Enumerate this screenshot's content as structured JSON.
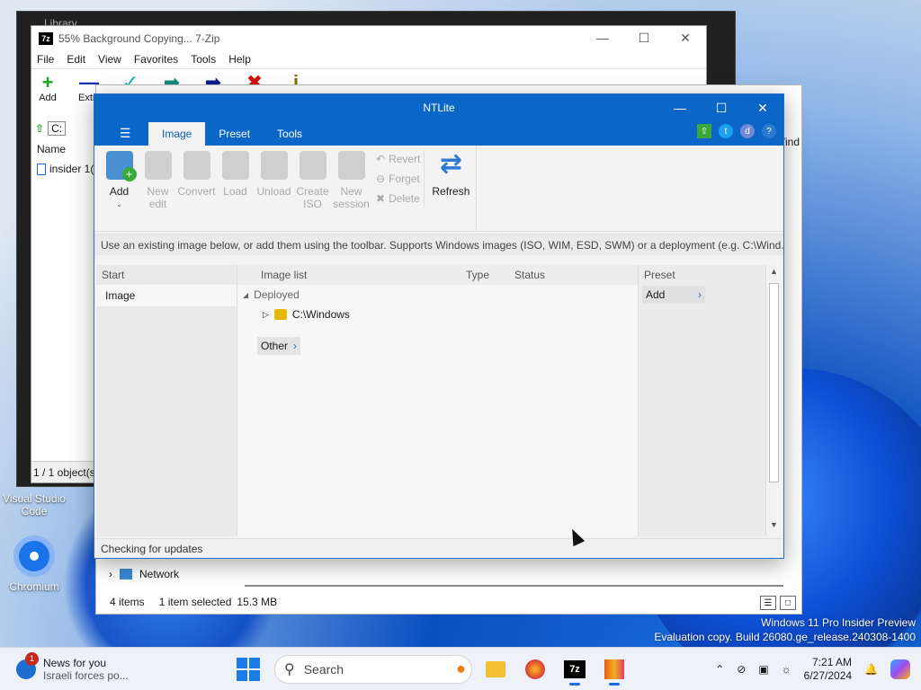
{
  "desktop": {
    "icons": [
      {
        "label": "Visual Studio Code"
      },
      {
        "label": "Chromium"
      }
    ],
    "watermark_line1": "Windows 11 Pro Insider Preview",
    "watermark_line2": "Evaluation copy. Build 26080.ge_release.240308-1400"
  },
  "library_window": {
    "title": "Library"
  },
  "zip_window": {
    "title": "55% Background Copying... 7-Zip",
    "menu": [
      "File",
      "Edit",
      "View",
      "Favorites",
      "Tools",
      "Help"
    ],
    "toolbar": [
      "Add",
      "Extra",
      "",
      "",
      "",
      "",
      ""
    ],
    "address": "C:",
    "column_name": "Name",
    "item": "insider 1(",
    "status": "1 / 1 object(s"
  },
  "explorer_window": {
    "nav_item": "Network",
    "status_items": "4 items",
    "status_selected": "1 item selected",
    "status_size": "15.3 MB",
    "fragment_right": "Wind"
  },
  "ntlite": {
    "title": "NTLite",
    "tabs": [
      "Image",
      "Preset",
      "Tools"
    ],
    "active_tab": "Image",
    "ribbon": {
      "add": "Add",
      "new_edit": "New edit",
      "convert": "Convert",
      "load": "Load",
      "unload": "Unload",
      "create_iso": "Create ISO",
      "new_session": "New session",
      "revert": "Revert",
      "forget": "Forget",
      "delete": "Delete",
      "refresh": "Refresh"
    },
    "hint": "Use an existing image below, or add them using the toolbar. Supports Windows images (ISO, WIM, ESD, SWM) or a deployment (e.g. C:\\Wind...",
    "left": {
      "header": "Start",
      "selected": "Image"
    },
    "columns": {
      "image_list": "Image list",
      "type": "Type",
      "status": "Status"
    },
    "tree": {
      "group": "Deployed",
      "item": "C:\\Windows"
    },
    "other_button": "Other",
    "preset": {
      "header": "Preset",
      "add_button": "Add"
    },
    "status": "Checking for updates"
  },
  "taskbar": {
    "news_title": "News for you",
    "news_subtitle": "Israeli forces po...",
    "news_badge": "1",
    "search_placeholder": "Search",
    "time": "7:21 AM",
    "date": "6/27/2024"
  }
}
